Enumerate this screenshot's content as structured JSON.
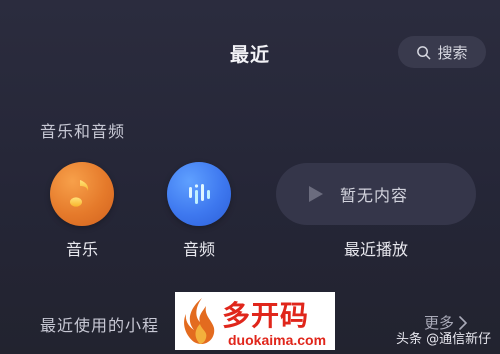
{
  "header": {
    "title": "最近",
    "search_label": "搜索"
  },
  "section": {
    "title": "音乐和音频"
  },
  "items": [
    {
      "label": "音乐",
      "icon": "music-note-icon",
      "color": "#e57a2b"
    },
    {
      "label": "音频",
      "icon": "audio-waveform-icon",
      "color": "#3e78ef"
    }
  ],
  "recent": {
    "empty_text": "暂无内容",
    "label": "最近播放"
  },
  "mini_programs": {
    "title": "最近使用的小程",
    "more_label": "更多"
  },
  "watermark": {
    "cn": "多开码",
    "en": "duokaima.com"
  },
  "source_tag": "头条 @通信新仔"
}
